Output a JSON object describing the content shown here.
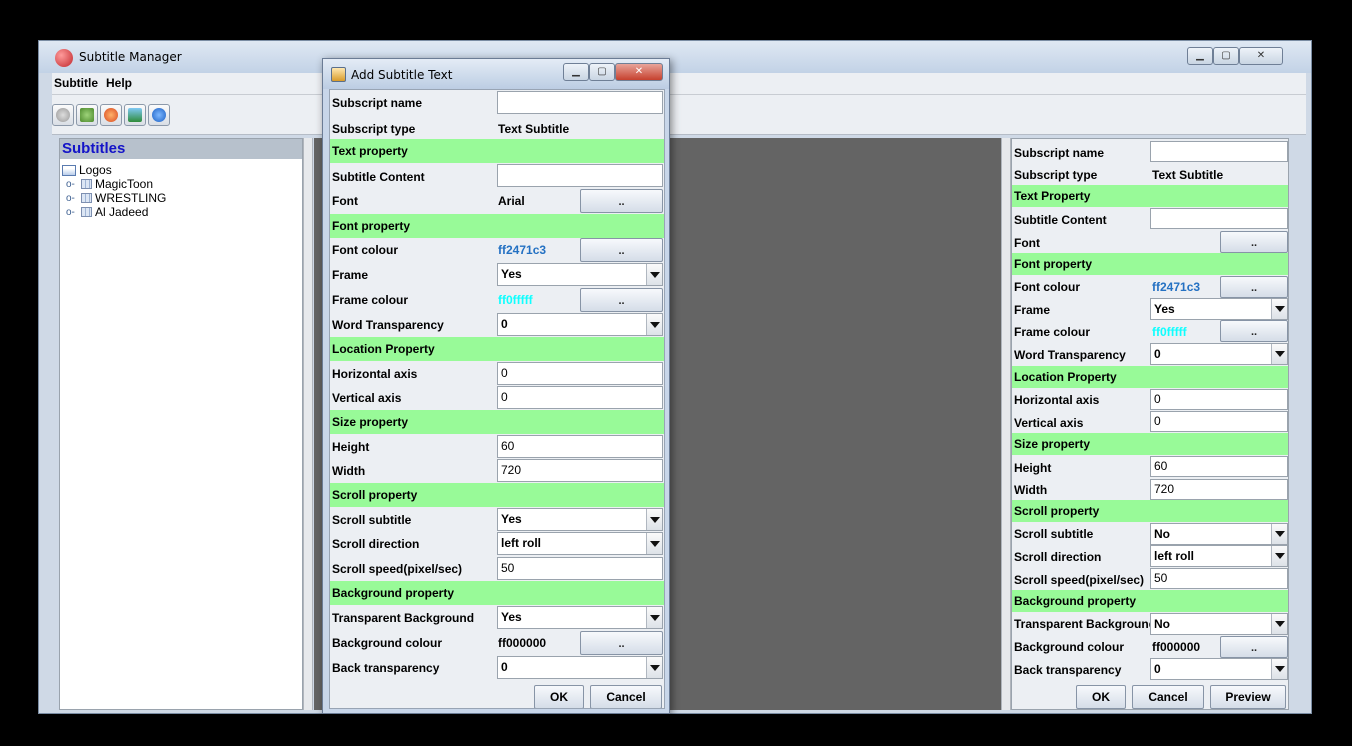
{
  "main_window": {
    "title": "Subtitle Manager",
    "menu": [
      "Subtitle",
      "Help"
    ],
    "toolbar_icons": [
      "add-subtitle-icon",
      "edit-subtitle-icon",
      "delete-subtitle-icon",
      "export-icon",
      "info-icon"
    ]
  },
  "tree": {
    "heading": "Subtitles",
    "root": "Logos",
    "items": [
      "MagicToon",
      "WRESTLING",
      "Al Jadeed"
    ]
  },
  "dialog": {
    "title": "Add Subtitle Text",
    "fields": {
      "subscript_name_label": "Subscript name",
      "subscript_name_value": "",
      "subscript_type_label": "Subscript type",
      "subscript_type_value": "Text Subtitle",
      "text_property": "Text property",
      "subtitle_content_label": "Subtitle Content",
      "subtitle_content_value": "",
      "font_label": "Font",
      "font_value": "Arial",
      "font_property": "Font property",
      "font_colour_label": "Font colour",
      "font_colour_value": "ff2471c3",
      "frame_label": "Frame",
      "frame_value": "Yes",
      "frame_colour_label": "Frame colour",
      "frame_colour_value": "ff0fffff",
      "word_transparency_label": "Word Transparency",
      "word_transparency_value": "0",
      "location_property": "Location Property",
      "horizontal_axis_label": "Horizontal axis",
      "horizontal_axis_value": "0",
      "vertical_axis_label": "Vertical axis",
      "vertical_axis_value": "0",
      "size_property": "Size property",
      "height_label": "Height",
      "height_value": "60",
      "width_label": "Width",
      "width_value": "720",
      "scroll_property": "Scroll property",
      "scroll_subtitle_label": "Scroll subtitle",
      "scroll_subtitle_value": "Yes",
      "scroll_direction_label": "Scroll direction",
      "scroll_direction_value": "left roll",
      "scroll_speed_label": "Scroll speed(pixel/sec)",
      "scroll_speed_value": "50",
      "background_property": "Background property",
      "transparent_background_label": "Transparent Background",
      "transparent_background_value": "Yes",
      "background_colour_label": "Background colour",
      "background_colour_value": "ff000000",
      "back_transparency_label": "Back transparency",
      "back_transparency_value": "0"
    },
    "ok_label": "OK",
    "cancel_label": "Cancel",
    "dots_label": ".."
  },
  "right_panel": {
    "fields": {
      "subscript_name_label": "Subscript name",
      "subscript_name_value": "",
      "subscript_type_label": "Subscript type",
      "subscript_type_value": "Text Subtitle",
      "text_property": "Text Property",
      "subtitle_content_label": "Subtitle Content",
      "subtitle_content_value": "",
      "font_label": "Font",
      "font_property": "Font property",
      "font_colour_label": "Font colour",
      "font_colour_value": "ff2471c3",
      "frame_label": "Frame",
      "frame_value": "Yes",
      "frame_colour_label": "Frame colour",
      "frame_colour_value": "ff0fffff",
      "word_transparency_label": "Word Transparency",
      "word_transparency_value": "0",
      "location_property": "Location Property",
      "horizontal_axis_label": "Horizontal axis",
      "horizontal_axis_value": "0",
      "vertical_axis_label": "Vertical axis",
      "vertical_axis_value": "0",
      "size_property": "Size property",
      "height_label": "Height",
      "height_value": "60",
      "width_label": "Width",
      "width_value": "720",
      "scroll_property": "Scroll property",
      "scroll_subtitle_label": "Scroll subtitle",
      "scroll_subtitle_value": "No",
      "scroll_direction_label": "Scroll direction",
      "scroll_direction_value": "left roll",
      "scroll_speed_label": "Scroll speed(pixel/sec)",
      "scroll_speed_value": "50",
      "background_property": "Background property",
      "transparent_background_label": "Transparent Background",
      "transparent_background_value": "No",
      "background_colour_label": "Background colour",
      "background_colour_value": "ff000000",
      "back_transparency_label": "Back transparency",
      "back_transparency_value": "0"
    },
    "ok_label": "OK",
    "cancel_label": "Cancel",
    "preview_label": "Preview",
    "dots_label": ".."
  },
  "colors": {
    "section_bg": "#98fa98",
    "font_colour_text": "#2471c3",
    "frame_colour_text": "#0fffff",
    "tree_heading": "#1414c8"
  }
}
